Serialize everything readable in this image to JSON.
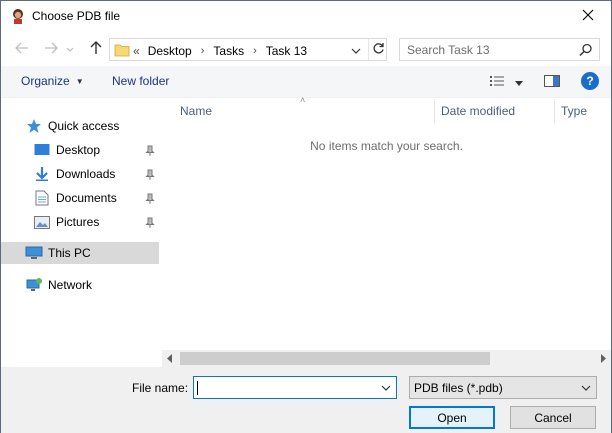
{
  "window": {
    "title": "Choose PDB file"
  },
  "address": {
    "lead": "«",
    "crumbs": [
      "Desktop",
      "Tasks",
      "Task 13"
    ]
  },
  "search": {
    "placeholder": "Search Task 13"
  },
  "toolbar": {
    "organize_label": "Organize",
    "new_folder_label": "New folder",
    "help_label": "?"
  },
  "nav": {
    "quick_access": "Quick access",
    "items": [
      {
        "label": "Desktop",
        "icon": "desktop-icon",
        "pinned": true
      },
      {
        "label": "Downloads",
        "icon": "downloads-icon",
        "pinned": true
      },
      {
        "label": "Documents",
        "icon": "documents-icon",
        "pinned": true
      },
      {
        "label": "Pictures",
        "icon": "pictures-icon",
        "pinned": true
      }
    ],
    "this_pc": "This PC",
    "network": "Network"
  },
  "columns": {
    "name": "Name",
    "date_modified": "Date modified",
    "type": "Type"
  },
  "content": {
    "empty_message": "No items match your search."
  },
  "footer": {
    "file_name_label": "File name:",
    "file_name_value": "",
    "file_type_value": "PDB files (*.pdb)",
    "open_label": "Open",
    "cancel_label": "Cancel"
  },
  "colors": {
    "accent": "#0078d7",
    "link_text": "#1e3287",
    "selected_bg": "#d9d9d9"
  }
}
